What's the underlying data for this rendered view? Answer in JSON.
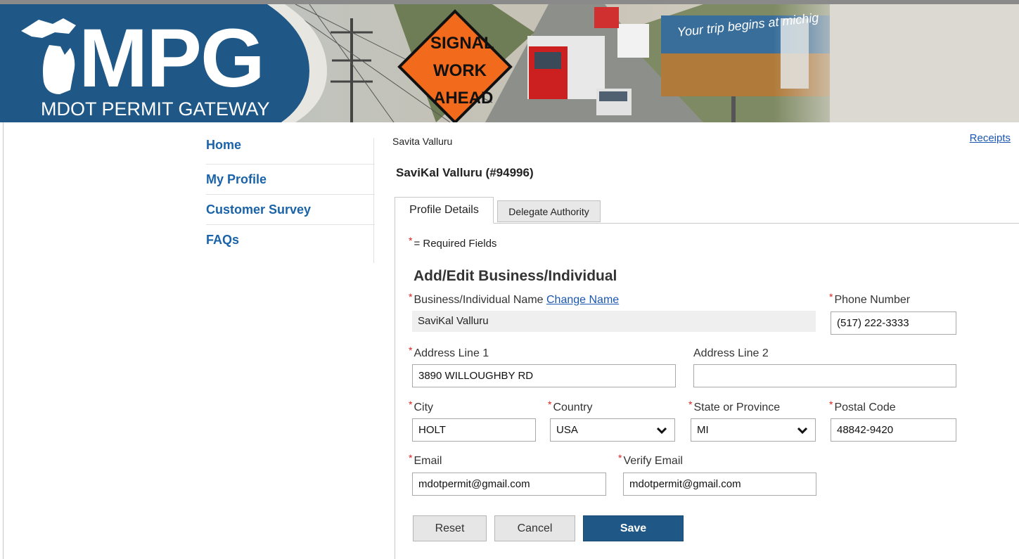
{
  "banner": {
    "logo_text": "MPG",
    "logo_subtitle": "MDOT PERMIT GATEWAY",
    "sign_text": [
      "SIGNAL",
      "WORK",
      "AHEAD"
    ],
    "billboard_text": "Your trip begins at michig"
  },
  "sidebar": {
    "items": [
      {
        "label": "Home"
      },
      {
        "label": "My Profile"
      },
      {
        "label": "Customer Survey"
      },
      {
        "label": "FAQs"
      }
    ]
  },
  "header": {
    "user_name": "Savita Valluru",
    "receipts_link": "Receipts",
    "account_title": "SaviKal Valluru (#94996)"
  },
  "tabs": [
    {
      "label": "Profile Details",
      "active": true
    },
    {
      "label": "Delegate Authority",
      "active": false
    }
  ],
  "form": {
    "required_note": "= Required Fields",
    "section_title": "Add/Edit Business/Individual",
    "business_name": {
      "label": "Business/Individual Name",
      "link": "Change Name",
      "value": "SaviKal Valluru"
    },
    "phone": {
      "label": "Phone Number",
      "value": "(517) 222-3333"
    },
    "address1": {
      "label": "Address Line 1",
      "value": "3890 WILLOUGHBY RD"
    },
    "address2": {
      "label": "Address Line 2",
      "value": ""
    },
    "city": {
      "label": "City",
      "value": "HOLT"
    },
    "country": {
      "label": "Country",
      "value": "USA"
    },
    "state": {
      "label": "State or Province",
      "value": "MI"
    },
    "postal": {
      "label": "Postal Code",
      "value": "48842-9420"
    },
    "email": {
      "label": "Email",
      "value": "mdotpermit@gmail.com"
    },
    "verify_email": {
      "label": "Verify Email",
      "value": "mdotpermit@gmail.com"
    }
  },
  "buttons": {
    "reset": "Reset",
    "cancel": "Cancel",
    "save": "Save"
  },
  "colors": {
    "brand_blue": "#1f5886",
    "link_blue": "#1a63a8",
    "required_red": "#e02020"
  }
}
